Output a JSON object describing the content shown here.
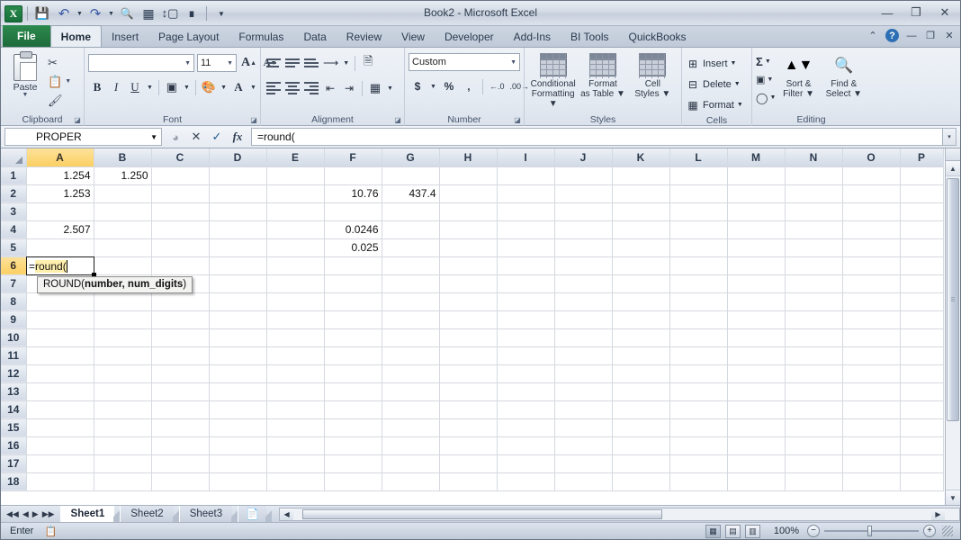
{
  "window": {
    "title": "Book2 - Microsoft Excel",
    "minimize": "—",
    "restore": "❐",
    "close": "✕"
  },
  "quick_access": {
    "items": [
      {
        "name": "excel-logo",
        "glyph": "X"
      },
      {
        "name": "save-icon",
        "glyph": "💾"
      },
      {
        "name": "undo-icon",
        "glyph": "↩"
      },
      {
        "name": "redo-icon",
        "glyph": "↪"
      },
      {
        "name": "print-preview-icon",
        "glyph": "🔍"
      },
      {
        "name": "grid-icon",
        "glyph": "▦"
      },
      {
        "name": "row-height-icon",
        "glyph": "↕"
      },
      {
        "name": "share-icon",
        "glyph": "⁂"
      },
      {
        "name": "customize-icon",
        "glyph": "▾"
      }
    ]
  },
  "tabs": {
    "file": "File",
    "items": [
      "Home",
      "Insert",
      "Page Layout",
      "Formulas",
      "Data",
      "Review",
      "View",
      "Developer",
      "Add-Ins",
      "BI Tools",
      "QuickBooks"
    ],
    "active": "Home",
    "right_controls": [
      "⌃",
      "?",
      "—",
      "❐",
      "✕"
    ]
  },
  "ribbon": {
    "clipboard": {
      "label": "Clipboard",
      "paste": "Paste",
      "cut": "Cut",
      "copy": "Copy",
      "format_painter": "Format Painter",
      "dialog_launcher": "◪"
    },
    "font": {
      "label": "Font",
      "font_name": "",
      "font_name_placeholder": "",
      "font_size": "11",
      "grow_font": "A",
      "shrink_font": "A",
      "bold": "B",
      "italic": "I",
      "underline": "U",
      "borders": "▦",
      "fill_color": "A",
      "font_color": "A",
      "dialog_launcher": "◪"
    },
    "alignment": {
      "label": "Alignment",
      "top_align": "top-align",
      "middle_align": "middle-align",
      "bottom_align": "bottom-align",
      "orientation": "orientation",
      "wrap_text": "Wrap Text",
      "align_left": "align-left",
      "align_center": "align-center",
      "align_right": "align-right",
      "decrease_indent": "decrease-indent",
      "increase_indent": "increase-indent",
      "merge_center": "Merge & Center",
      "dialog_launcher": "◪"
    },
    "number": {
      "label": "Number",
      "format": "Custom",
      "accounting": "$",
      "percent": "%",
      "comma": ",",
      "increase_decimal": "◄.0",
      "decrease_decimal": ".00",
      "dialog_launcher": "◪"
    },
    "styles": {
      "label": "Styles",
      "conditional_formatting": "Conditional\nFormatting",
      "conditional_formatting_l1": "Conditional",
      "conditional_formatting_l2": "Formatting",
      "format_as_table_l1": "Format",
      "format_as_table_l2": "as Table",
      "cell_styles_l1": "Cell",
      "cell_styles_l2": "Styles"
    },
    "cells": {
      "label": "Cells",
      "insert": "Insert",
      "delete": "Delete",
      "format": "Format"
    },
    "editing": {
      "label": "Editing",
      "autosum": "Σ",
      "fill": "▣",
      "clear": "✦",
      "sort_filter_l1": "Sort &",
      "sort_filter_l2": "Filter",
      "find_select_l1": "Find &",
      "find_select_l2": "Select"
    }
  },
  "formula_bar": {
    "name_box": "PROPER",
    "name_box_caret": "▾",
    "cancel": "✕",
    "enter": "✓",
    "insert_function": "fx",
    "formula": "=round(",
    "expand": "▾"
  },
  "grid": {
    "columns": [
      "A",
      "B",
      "C",
      "D",
      "E",
      "F",
      "G",
      "H",
      "I",
      "J",
      "K",
      "L",
      "M",
      "N",
      "O",
      "P"
    ],
    "selected_column": "A",
    "rows": [
      1,
      2,
      3,
      4,
      5,
      6,
      7,
      8,
      9,
      10,
      11,
      12,
      13,
      14,
      15,
      16,
      17,
      18
    ],
    "selected_row": 6,
    "cells": [
      {
        "row": 1,
        "col": "A",
        "value": "1.254"
      },
      {
        "row": 1,
        "col": "B",
        "value": "1.250"
      },
      {
        "row": 2,
        "col": "A",
        "value": "1.253"
      },
      {
        "row": 2,
        "col": "F",
        "value": "10.76"
      },
      {
        "row": 2,
        "col": "G",
        "value": "437.4"
      },
      {
        "row": 4,
        "col": "A",
        "value": "2.507"
      },
      {
        "row": 4,
        "col": "F",
        "value": "0.0246"
      },
      {
        "row": 5,
        "col": "F",
        "value": "0.025"
      }
    ],
    "editing_cell": {
      "address": "A6",
      "text_plain": "=",
      "text_highlight": "round("
    },
    "tooltip": {
      "prefix": "ROUND(",
      "bold": "number, num_digits",
      "suffix": ")"
    }
  },
  "sheet_tabs": {
    "nav": [
      "◀◀",
      "◀",
      "▶",
      "▶▶"
    ],
    "items": [
      "Sheet1",
      "Sheet2",
      "Sheet3"
    ],
    "active": "Sheet1",
    "new_sheet_icon": "new-sheet-icon"
  },
  "status_bar": {
    "mode": "Enter",
    "macro_record_icon": "record-macro-icon",
    "views": [
      "normal-view",
      "page-layout-view",
      "page-break-view"
    ],
    "zoom": "100%",
    "zoom_out": "−",
    "zoom_in": "+"
  }
}
